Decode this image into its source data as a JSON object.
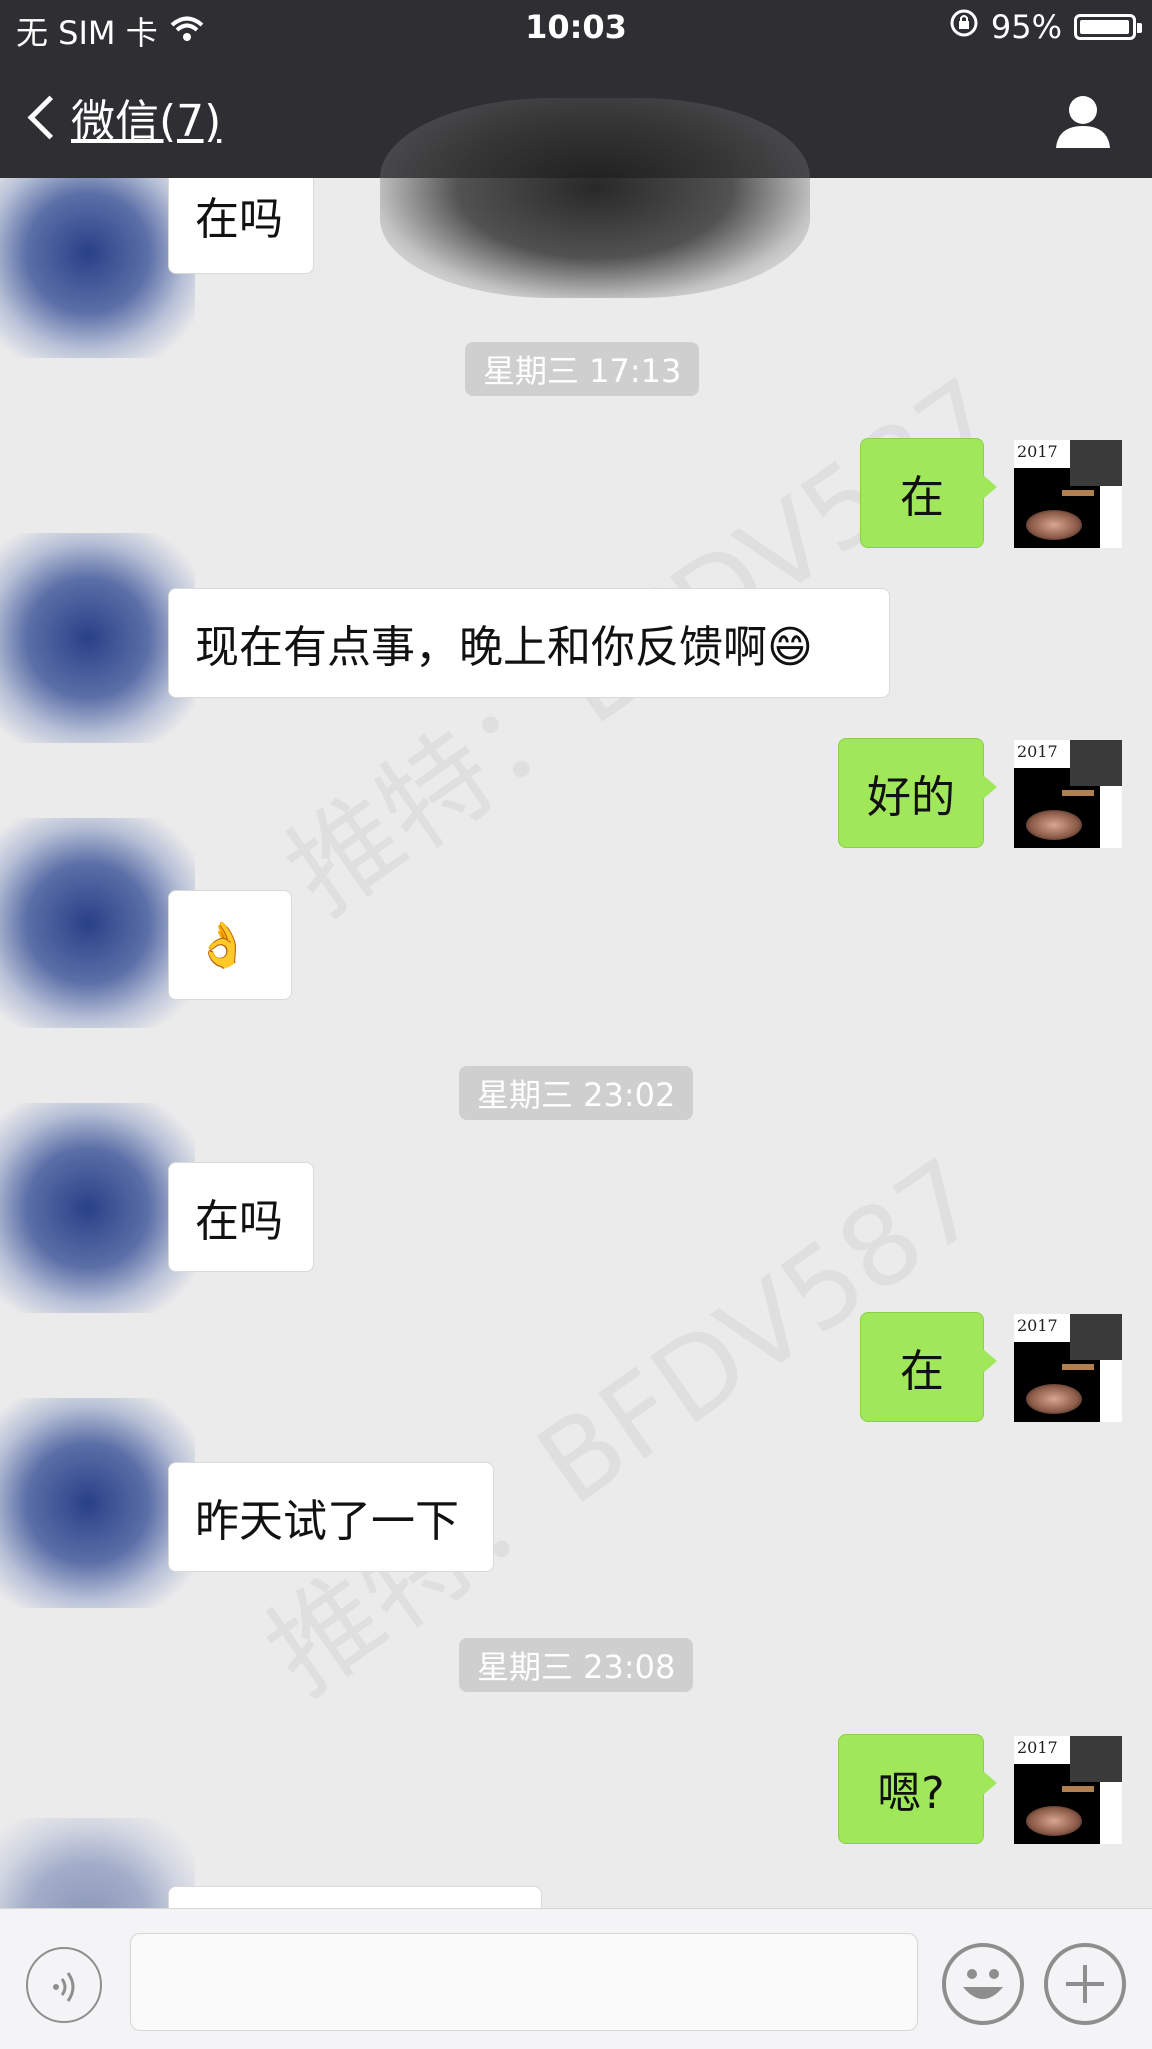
{
  "status_bar": {
    "carrier": "无 SIM 卡",
    "time": "10:03",
    "battery": "95%",
    "battery_level": 0.95
  },
  "nav": {
    "back_label": "微信(7)"
  },
  "watermark": "推特：BFDV587",
  "messages": [
    {
      "side": "left",
      "text": "在吗"
    },
    {
      "type": "time",
      "text": "星期三 17:13"
    },
    {
      "side": "right",
      "text": "在",
      "avatar_year": "2017"
    },
    {
      "side": "left",
      "text": "现在有点事，晚上和你反馈啊😄"
    },
    {
      "side": "right",
      "text": "好的",
      "avatar_year": "2017"
    },
    {
      "side": "left",
      "text": "👌"
    },
    {
      "type": "time",
      "text": "星期三 23:02"
    },
    {
      "side": "left",
      "text": "在吗"
    },
    {
      "side": "right",
      "text": "在",
      "avatar_year": "2017"
    },
    {
      "side": "left",
      "text": "昨天试了一下"
    },
    {
      "type": "time",
      "text": "星期三 23:08"
    },
    {
      "side": "right",
      "text": "嗯?",
      "avatar_year": "2017"
    },
    {
      "side": "left",
      "text": ""
    }
  ],
  "input": {
    "placeholder": ""
  }
}
